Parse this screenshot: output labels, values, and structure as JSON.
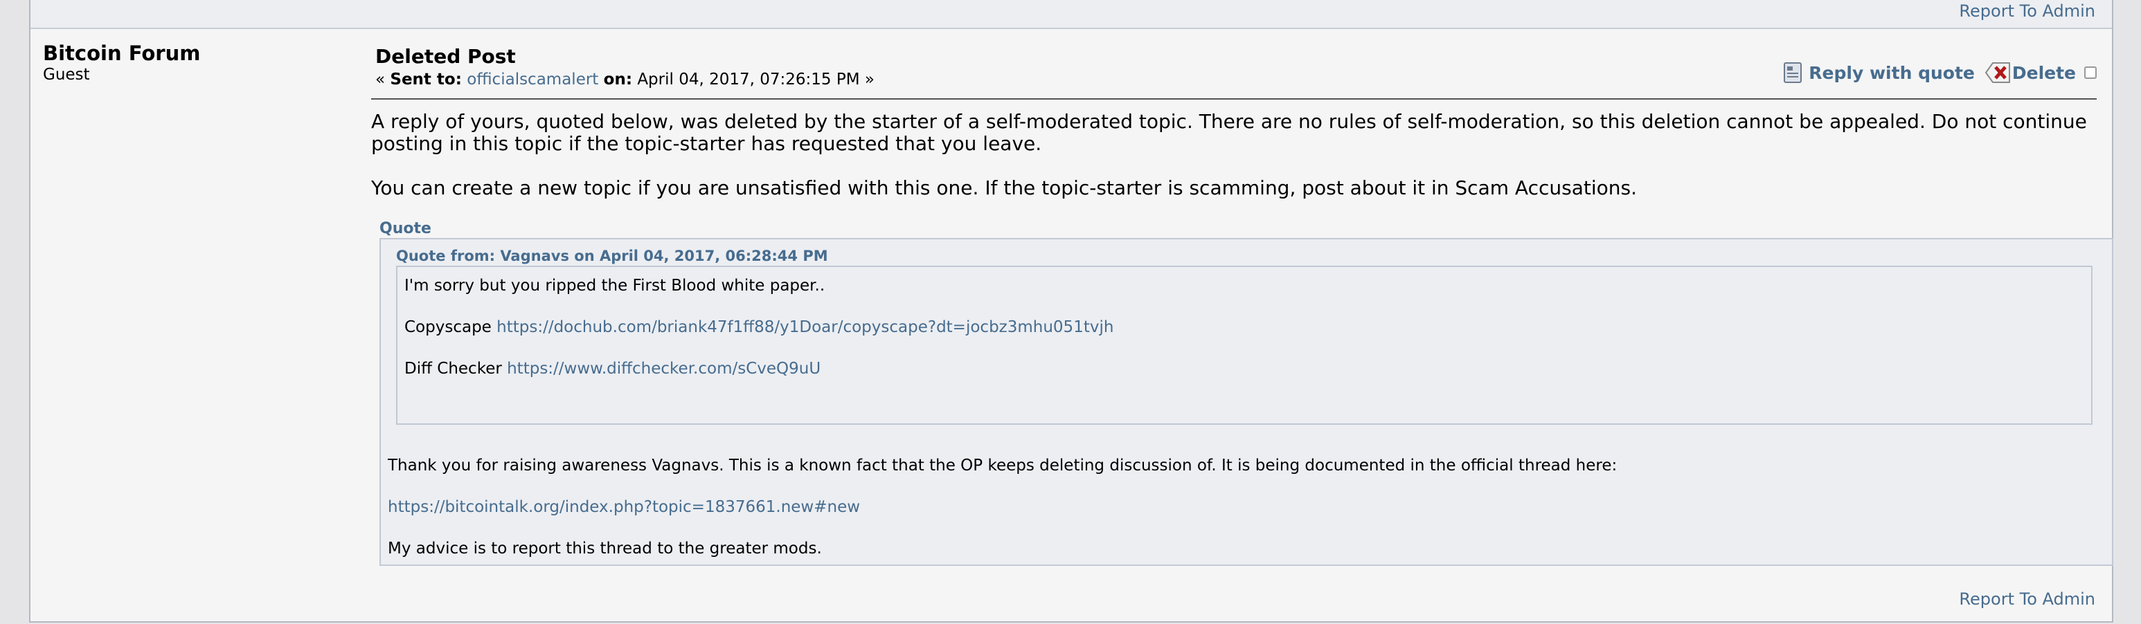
{
  "report_link": "Report To Admin",
  "poster": {
    "name": "Bitcoin Forum",
    "title": "Guest"
  },
  "post": {
    "subject": "Deleted Post",
    "meta_open": "«",
    "sent_to_label": "Sent to:",
    "recipient": "officialscamalert",
    "on_label": "on:",
    "date": "April 04, 2017, 07:26:15 PM",
    "meta_close": "»",
    "body_paragraphs": [
      "A reply of yours, quoted below, was deleted by the starter of a self-moderated topic. There are no rules of self-moderation, so this deletion cannot be appealed. Do not continue posting in this topic if the topic-starter has requested that you leave.",
      "You can create a new topic if you are unsatisfied with this one. If the topic-starter is scamming, post about it in Scam Accusations."
    ]
  },
  "actions": {
    "reply_quote": "Reply with quote",
    "delete": "Delete"
  },
  "quote": {
    "header": "Quote",
    "nested_header": "Quote from: Vagnavs on April 04, 2017, 06:28:44 PM",
    "nested_lines": {
      "line1": "I'm sorry but you ripped the First Blood white paper..",
      "copyscape_label": "Copyscape",
      "copyscape_url": "https://dochub.com/briank47f1ff88/y1Doar/copyscape?dt=jocbz3mhu051tvjh",
      "diff_label": "Diff Checker",
      "diff_url": "https://www.diffchecker.com/sCveQ9uU"
    },
    "outer_lines": {
      "line1": "Thank you for raising awareness Vagnavs. This is a known fact that the OP keeps deleting discussion of. It is being documented in the official thread here:",
      "thread_url": "https://bitcointalk.org/index.php?topic=1837661.new#new",
      "line3": "My advice is to report this thread to the greater mods."
    }
  },
  "icons": {
    "quote": "reply-with-quote-icon",
    "delete": "delete-icon"
  },
  "colors": {
    "link": "#476c8e",
    "background": "#f5f5f5",
    "quote_bg": "#eceef2",
    "quote_border": "#c2c9d3"
  }
}
